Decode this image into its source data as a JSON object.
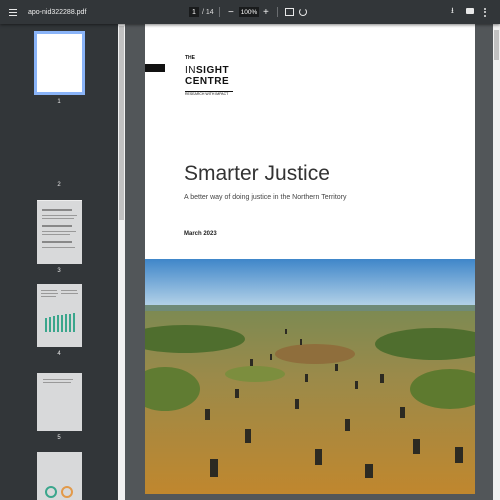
{
  "toolbar": {
    "file_name": "apo-nid322288.pdf",
    "current_page": "1",
    "total_pages": "/ 14",
    "zoom": "100%",
    "zoom_out": "−",
    "zoom_in": "+",
    "download_glyph": "⭳"
  },
  "thumbnails": [
    {
      "label": "1"
    },
    {
      "label": "2"
    },
    {
      "label": "3"
    },
    {
      "label": "4"
    },
    {
      "label": "5"
    }
  ],
  "document": {
    "logo_the": "THE",
    "logo_in": "IN",
    "logo_sight": "SIGHT",
    "logo_centre": "CENTRE",
    "logo_tagline": "RESEARCH WITH IMPACT",
    "title": "Smarter Justice",
    "subtitle": "A better way of doing justice in the Northern Territory",
    "date": "March 2023"
  },
  "colors": {
    "toolbar_bg": "#323639",
    "viewer_bg": "#525659",
    "selection": "#8ab4f8"
  },
  "icons": [
    "menu-icon",
    "fit-page-icon",
    "rotate-icon",
    "download-icon",
    "print-icon",
    "more-options-icon"
  ]
}
